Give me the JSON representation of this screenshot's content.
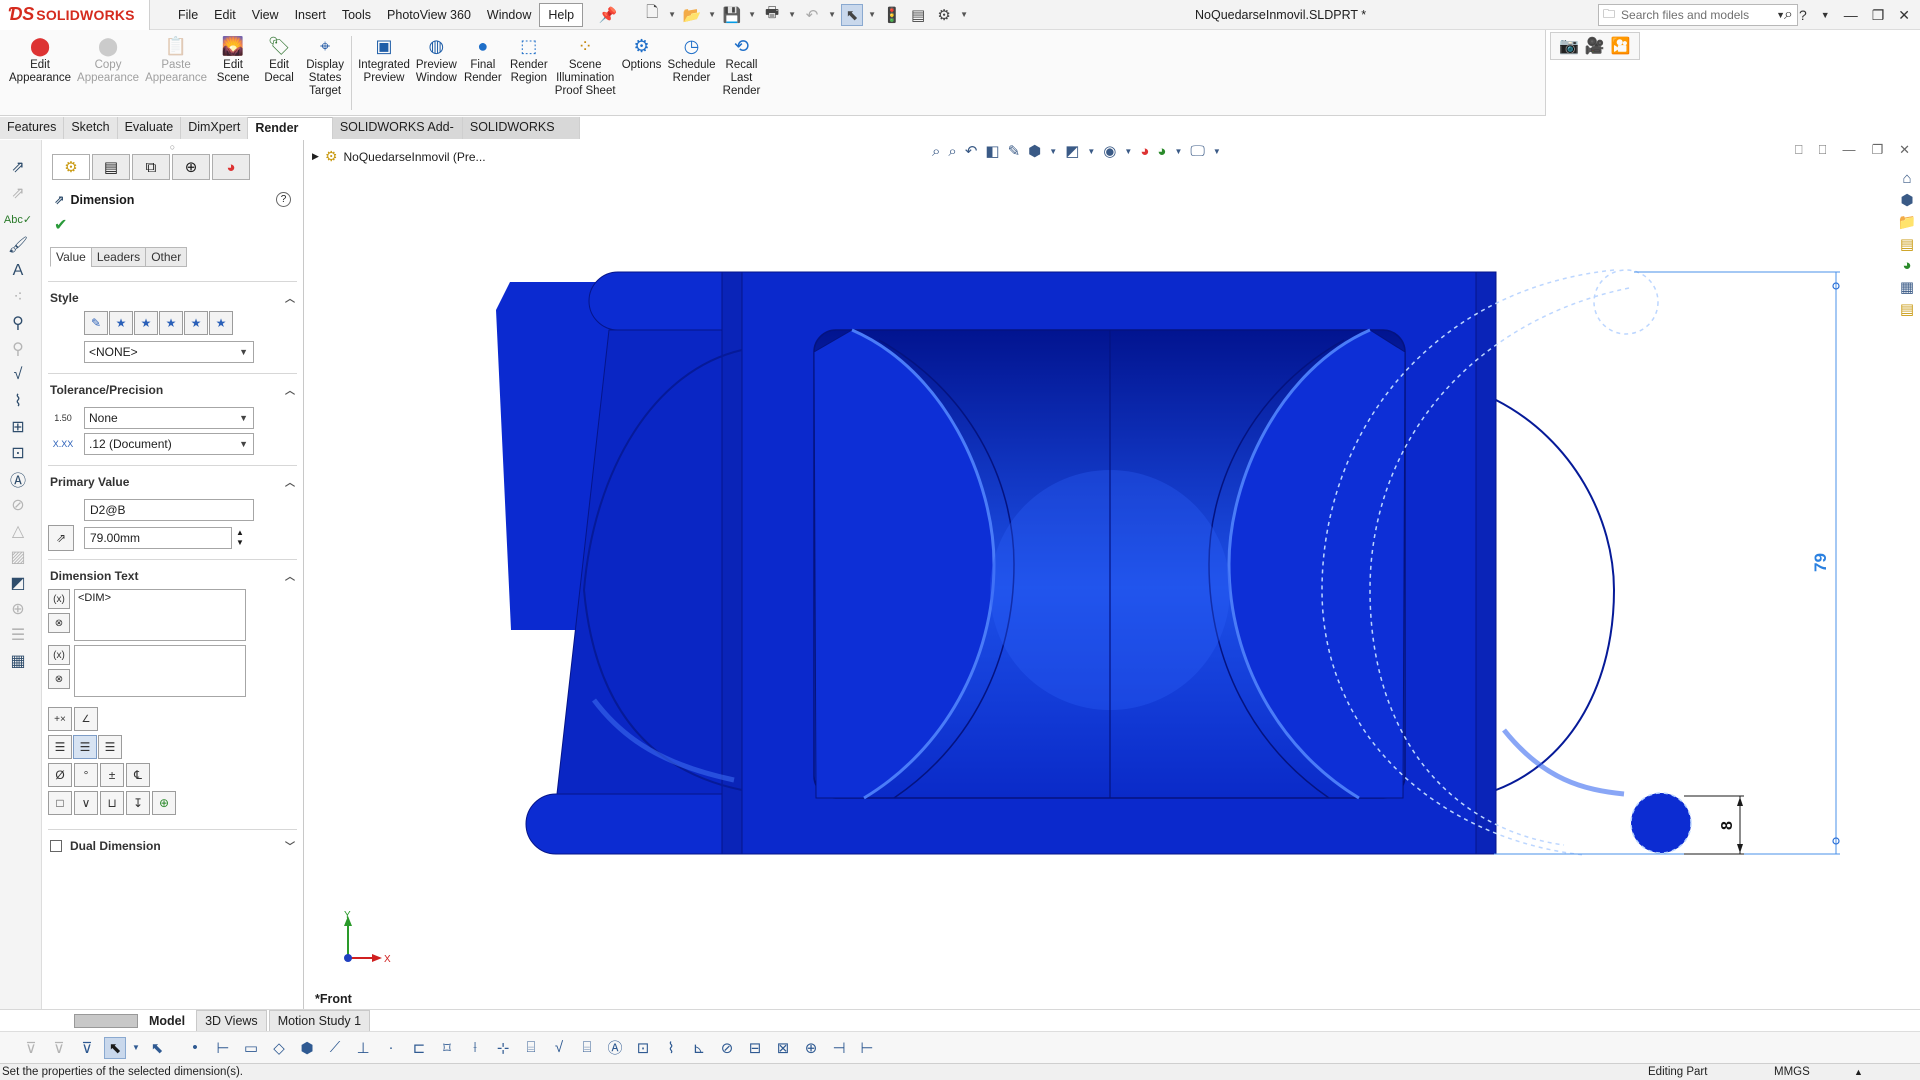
{
  "app": {
    "brand": "SOLIDWORKS",
    "document_title": "NoQuedarseInmovil.SLDPRT *",
    "menu": [
      "File",
      "Edit",
      "View",
      "Insert",
      "Tools",
      "PhotoView 360",
      "Window",
      "Help"
    ],
    "search_placeholder": "Search files and models"
  },
  "command_manager": {
    "buttons": [
      {
        "label": "Edit\nAppearance",
        "icon": "appearance-icon",
        "enabled": true
      },
      {
        "label": "Copy\nAppearance",
        "icon": "copy-appearance-icon",
        "enabled": false
      },
      {
        "label": "Paste\nAppearance",
        "icon": "paste-appearance-icon",
        "enabled": false
      },
      {
        "label": "Edit\nScene",
        "icon": "scene-icon",
        "enabled": true
      },
      {
        "label": "Edit\nDecal",
        "icon": "decal-icon",
        "enabled": true
      },
      {
        "label": "Display\nStates\nTarget",
        "icon": "display-states-icon",
        "enabled": true
      },
      {
        "label": "Integrated\nPreview",
        "icon": "integrated-preview-icon",
        "enabled": true
      },
      {
        "label": "Preview\nWindow",
        "icon": "preview-window-icon",
        "enabled": true
      },
      {
        "label": "Final\nRender",
        "icon": "final-render-icon",
        "enabled": true
      },
      {
        "label": "Render\nRegion",
        "icon": "render-region-icon",
        "enabled": true
      },
      {
        "label": "Scene\nIllumination\nProof Sheet",
        "icon": "proof-sheet-icon",
        "enabled": true
      },
      {
        "label": "Options",
        "icon": "options-icon",
        "enabled": true
      },
      {
        "label": "Schedule\nRender",
        "icon": "schedule-render-icon",
        "enabled": true
      },
      {
        "label": "Recall\nLast\nRender",
        "icon": "recall-render-icon",
        "enabled": true
      }
    ],
    "tabs": [
      "Features",
      "Sketch",
      "Evaluate",
      "DimXpert",
      "Render Tools",
      "SOLIDWORKS Add-Ins",
      "SOLIDWORKS MBD"
    ],
    "active_tab": "Render Tools"
  },
  "property_manager": {
    "title": "Dimension",
    "help": "?",
    "subtabs": [
      "Value",
      "Leaders",
      "Other"
    ],
    "style": {
      "title": "Style",
      "selected": "<NONE>"
    },
    "tolerance": {
      "title": "Tolerance/Precision",
      "tolerance_type": "None",
      "precision": ".12 (Document)",
      "tol_icon_text": "1.50",
      "prec_icon_text": "X.XX"
    },
    "primary_value": {
      "title": "Primary Value",
      "name": "D2@B",
      "value": "79.00mm"
    },
    "dimension_text": {
      "title": "Dimension Text",
      "text": "<DIM>"
    },
    "dual_dimension": {
      "label": "Dual Dimension",
      "checked": false
    }
  },
  "graphics": {
    "feature_tree_root": "NoQuedarseInmovil  (Pre...",
    "view_label": "*Front",
    "dimension_79": "79",
    "dimension_8": "8",
    "part_color": "#0a28c8",
    "triad_x": "X",
    "triad_y": "Y"
  },
  "bottom_tabs": [
    "Model",
    "3D Views",
    "Motion Study 1"
  ],
  "active_bottom_tab": "Model",
  "status": {
    "message": "Set the properties of the selected dimension(s).",
    "mode": "Editing Part",
    "units": "MMGS"
  }
}
